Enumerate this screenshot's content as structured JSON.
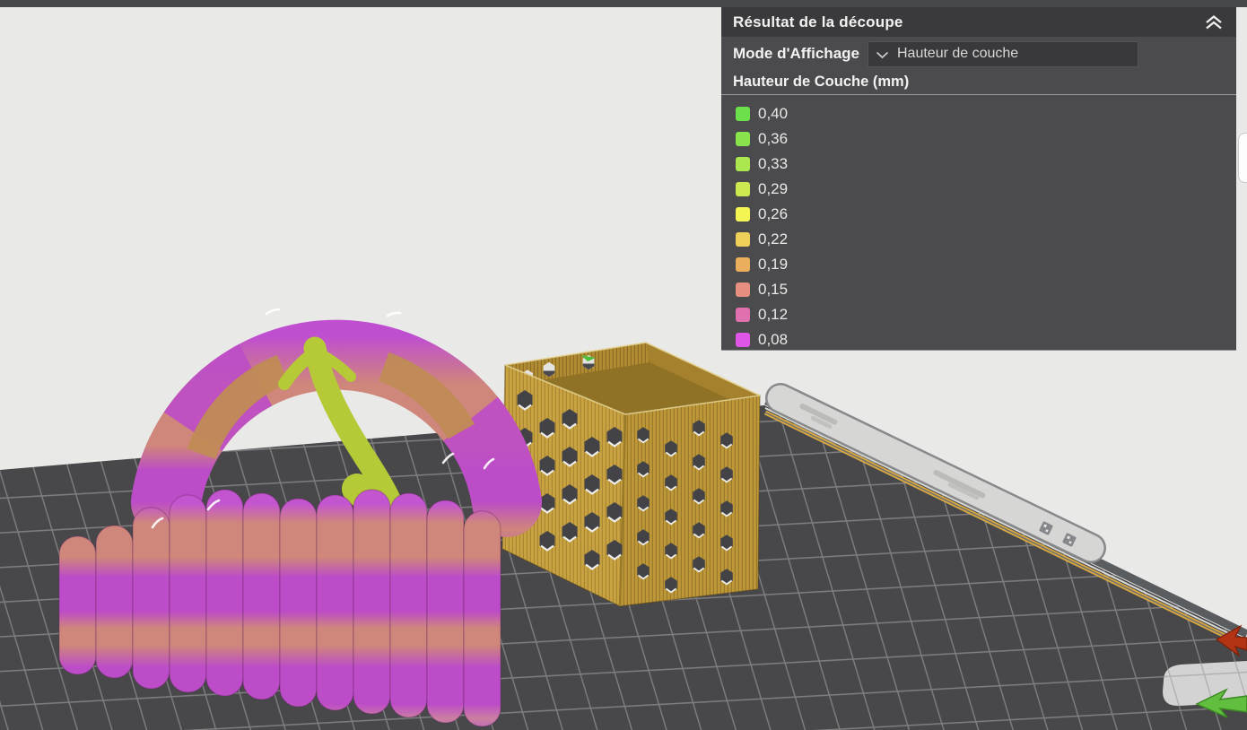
{
  "panel": {
    "title": "Résultat de la découpe",
    "collapse_icon": "double-chevron-up-icon",
    "display_mode": {
      "label": "Mode d'Affichage",
      "selected": "Hauteur de couche",
      "dropdown_icon": "chevron-down-icon"
    },
    "legend": {
      "title": "Hauteur de Couche (mm)",
      "items": [
        {
          "value": "0,40",
          "color": "#6CE04A"
        },
        {
          "value": "0,36",
          "color": "#8BE34C"
        },
        {
          "value": "0,33",
          "color": "#ABE74E"
        },
        {
          "value": "0,29",
          "color": "#CCEA50"
        },
        {
          "value": "0,26",
          "color": "#F4F452"
        },
        {
          "value": "0,22",
          "color": "#EFD058"
        },
        {
          "value": "0,19",
          "color": "#EBAE5C"
        },
        {
          "value": "0,15",
          "color": "#E68E80"
        },
        {
          "value": "0,12",
          "color": "#E170B0"
        },
        {
          "value": "0,08",
          "color": "#DF55E5"
        }
      ]
    }
  },
  "viewport": {
    "background_color": "#E9E9E7",
    "top_bar_color": "#45494B",
    "build_plate": {
      "surface_color": "#48484B",
      "grid_line_color": "#8E8E8E",
      "edge_accent_color": "#D9A93F",
      "side_strip_color": "#D6D6D4",
      "logo_area_color": "#D3D3D3",
      "side_icons": [
        "qr-code-icon",
        "qr-code-icon"
      ]
    },
    "axis_arrows": {
      "x_color": "#B23414",
      "y_color": "#62BE3E"
    },
    "models": {
      "wavy_basket": {
        "body_color": "#CF867B",
        "band_color": "#BC4CC8",
        "inner_color": "#C08B55"
      },
      "hex_basket": {
        "color": "#C9A341"
      },
      "support_tree": {
        "color": "#B6C937"
      }
    }
  }
}
